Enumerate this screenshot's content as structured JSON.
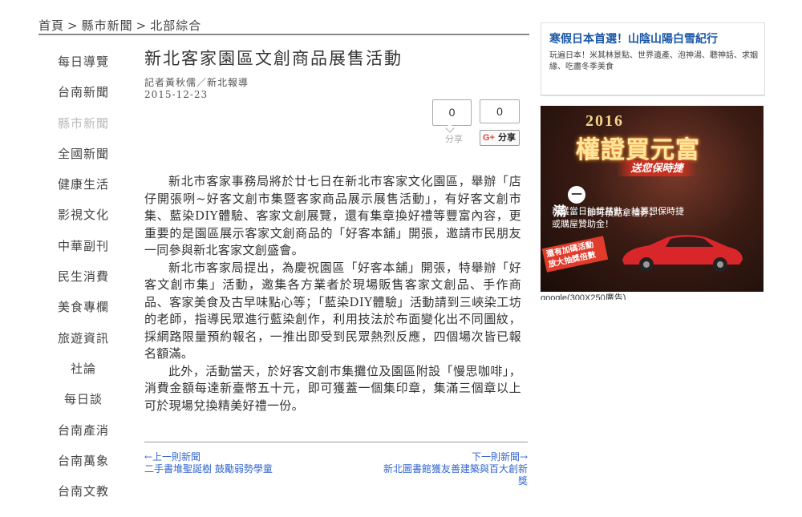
{
  "breadcrumb": {
    "home": "首頁",
    "sep": ">",
    "county": "縣市新聞",
    "region": "北部綜合"
  },
  "sidebar": {
    "items": [
      {
        "label": "每日導覽",
        "active": false
      },
      {
        "label": "台南新聞",
        "active": false
      },
      {
        "label": "縣市新聞",
        "active": true
      },
      {
        "label": "全國新聞",
        "active": false
      },
      {
        "label": "健康生活",
        "active": false
      },
      {
        "label": "影視文化",
        "active": false
      },
      {
        "label": "中華副刊",
        "active": false
      },
      {
        "label": "民生消費",
        "active": false
      },
      {
        "label": "美食專欄",
        "active": false
      },
      {
        "label": "旅遊資訊",
        "active": false
      },
      {
        "label": "社論",
        "active": false
      },
      {
        "label": "每日談",
        "active": false
      },
      {
        "label": "台南產消",
        "active": false
      },
      {
        "label": "台南萬象",
        "active": false
      },
      {
        "label": "台南文教",
        "active": false
      }
    ]
  },
  "article": {
    "title": "新北客家園區文創商品展售活動",
    "byline": "記者黃秋儒／新北報導",
    "date": "2015-12-23",
    "paragraphs": [
      "新北市客家事務局將於廿七日在新北市客家文化園區，舉辦「店仔開張咧~好客文創市集暨客家商品展示展售活動」，有好客文創市集、藍染DIY體驗、客家文創展覽，還有集章換好禮等豐富內容，更重要的是園區展示客家文創商品的「好客本舖」開張，邀請市民朋友一同參與新北客家文創盛會。",
      "新北市客家局提出，為慶祝園區「好客本舖」開張，特舉辦「好客文創市集」活動，邀集各方業者於現場販售客家文創品、手作商品、客家美食及古早味點心等；「藍染DIY體驗」活動請到三峽染工坊的老師，指導民眾進行藍染創作，利用技法於布面變化出不同圖紋，採網路限量預約報名，一推出即受到民眾熱烈反應，四個場次皆已報名額滿。",
      "此外，活動當天，於好客文創市集攤位及園區附設「慢思咖啡」，消費金額每達新臺幣五十元，即可獲蓋一個集印章，集滿三個章以上可於現場兌換精美好禮一份。"
    ]
  },
  "share": {
    "fb_count": "0",
    "fb_label": "分享",
    "gp_count": "0",
    "gp_icon": "G+",
    "gp_label": "分享"
  },
  "pager": {
    "prev_label": "←上一則新聞",
    "prev_title": "二手書堆聖誕樹 鼓勵弱勢學童",
    "next_label": "下一則新聞→",
    "next_title": "新北圖書館獲友善建築與百大創新獎"
  },
  "ad_text": {
    "title": "寒假日本首選！山陰山陽白雪紀行",
    "desc": "玩遍日本！米其林景點、世界遺產、泡神湯、聽神話、求姻緣、吃盡冬季美食"
  },
  "ad_banner": {
    "year": "2016",
    "headline": "權證買元富",
    "sub": "送您保時捷",
    "line1_prefix": "滿",
    "line1_circle": "一萬",
    "line1_suffix": "即可積點拿禮券，",
    "line2": "再獲當日抽獎基數，抽夢想保時捷",
    "line3": "或購屋贊助金！",
    "tag": "還有加碼活動 放大抽獎倍數",
    "footer": "google(300X250廣告)"
  },
  "colors": {
    "link": "#3366cc",
    "ad_title": "#1a56a8",
    "accent_red": "#e03b2b"
  }
}
